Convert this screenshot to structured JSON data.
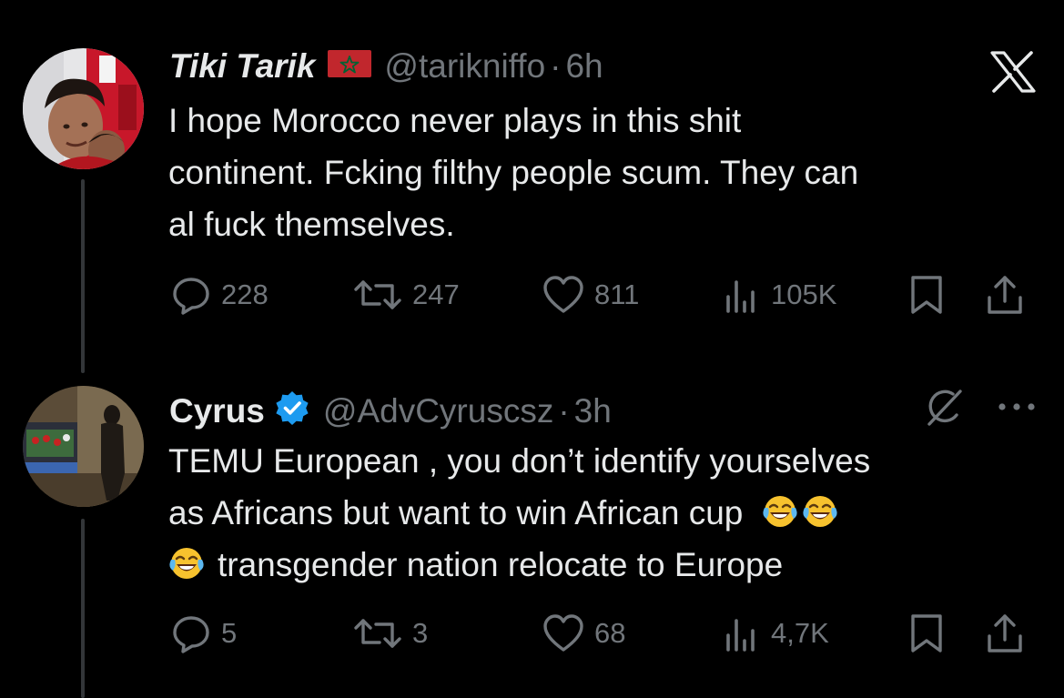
{
  "tweets": [
    {
      "author_name": "Tiki Tarik",
      "flag": "Morocco flag",
      "handle": "@tarikniffo",
      "separator": "·",
      "time": "6h",
      "text_lines": [
        "I hope Morocco never plays in this shit",
        "continent. Fcking filthy people scum. They can",
        "al fuck themselves."
      ],
      "replies": "228",
      "reposts": "247",
      "likes": "811",
      "views": "105K"
    },
    {
      "author_name": "Cyrus",
      "verified": true,
      "handle": "@AdvCyruscsz",
      "separator": "·",
      "time": "3h",
      "text_lines": [
        "TEMU European , you don’t identify yourselves",
        "as Africans but want to win African cup",
        "transgender nation relocate to Europe"
      ],
      "emoji": "face-with-tears-of-joy",
      "replies": "5",
      "reposts": "3",
      "likes": "68",
      "views": "4,7K"
    }
  ],
  "colors": {
    "background": "#000000",
    "text": "#e7e9ea",
    "muted": "#71767b",
    "verified": "#1d9bf0",
    "thread_line": "#333639"
  },
  "icons": {
    "logo": "x-logo-icon",
    "grok": "grok-icon",
    "more": "more-icon",
    "reply": "reply-icon",
    "repost": "repost-icon",
    "like": "heart-icon",
    "views": "views-icon",
    "bookmark": "bookmark-icon",
    "share": "share-icon"
  }
}
